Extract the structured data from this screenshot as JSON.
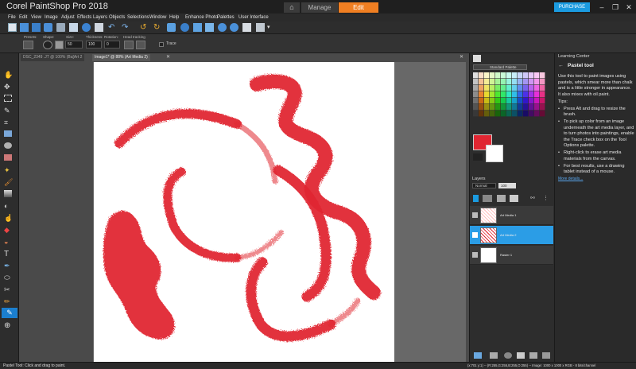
{
  "app": {
    "title": "Corel PaintShop Pro 2018",
    "tabs": {
      "manage": "Manage",
      "edit": "Edit"
    },
    "purchase": "PURCHASE"
  },
  "menu": [
    "File",
    "Edit",
    "View",
    "Image",
    "Adjust",
    "Effects",
    "Layers",
    "Objects",
    "Selections",
    "Window",
    "Help",
    "Enhance Photo",
    "Palettes",
    "User Interface"
  ],
  "tool_options": {
    "presets": "Presets:",
    "shape": "Shape:",
    "size": "Size:",
    "size_value": "50",
    "thickness": "Thickness:",
    "thickness_value": "100",
    "rotation": "Rotation:",
    "rotation_value": "0",
    "head_tracking": "Head tracking",
    "trace": "Trace"
  },
  "documents": {
    "tab1": "DSC_2349 .JT @ 100% (Ba[Art 2",
    "tab2": "Image1* @  88% (Art Media 2)"
  },
  "materials": {
    "palette_select": "Standard Palette"
  },
  "layers": {
    "title": "Layers",
    "blend_mode": "Normal",
    "opacity": "100",
    "rows": [
      {
        "name": "Art Media 1",
        "selected": false
      },
      {
        "name": "Art Media 2",
        "selected": true
      },
      {
        "name": "Raster 1",
        "selected": false
      }
    ]
  },
  "learning_center": {
    "title": "Learning Center",
    "tool_name": "Pastel tool",
    "description": "Use this tool to paint images using pastels, which smear more than chalk and is a little stronger in appearance. It also mixes with oil paint.",
    "tips_label": "Tips:",
    "tips": [
      "Press Alt and drag to resize the brush.",
      "To pick up color from an image underneath the art media layer, and to turn photos into paintings, enable the Trace check box on the Tool Options palette.",
      "Right-click to erase art media materials from the canvas.",
      "For best results, use a drawing tablet instead of a mouse."
    ],
    "more_link": "More details..."
  },
  "status": {
    "left": "Pastel Tool: Click and drag to paint.",
    "right": "(x:701 y:1) -- (R:255,G:255,B:255,O:255) -- Image: 1000 x 1000 x RGB - 8 bits/channel"
  },
  "colors": {
    "accent_orange": "#f07f22",
    "selected_blue": "#2b9de6",
    "paint_red": "#e02632"
  }
}
